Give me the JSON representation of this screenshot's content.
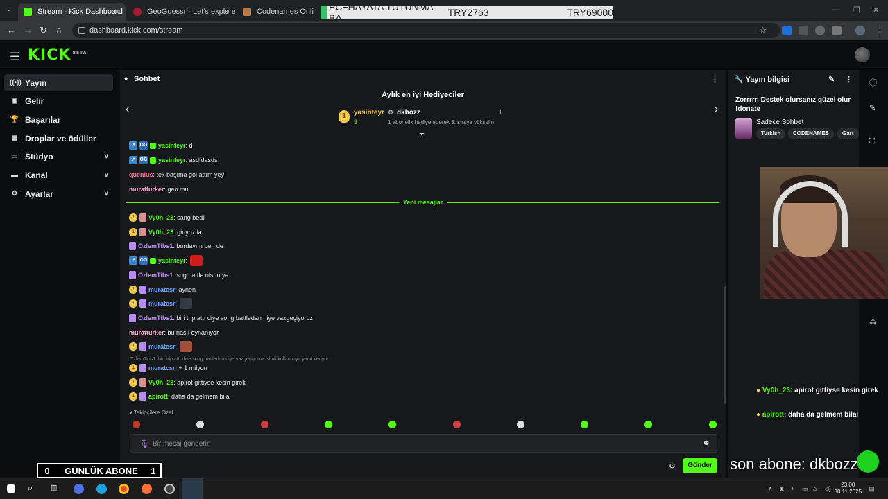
{
  "browser": {
    "tabs": [
      {
        "label": "Stream - Kick Dashboard",
        "active": true,
        "color": "#53fc18"
      },
      {
        "label": "GeoGuessr - Let's explore the w",
        "active": false,
        "color": "#a51c30"
      },
      {
        "label": "Codenames Online",
        "active": false,
        "color": "#b97a4a"
      }
    ],
    "url": "dashboard.kick.com/stream"
  },
  "banner": {
    "left": "PC+HAYATA TUTUNMA BA",
    "middle": "TRY2763",
    "right": "TRY69000"
  },
  "kick": {
    "logo": "KICK",
    "logo_sup": "BETA"
  },
  "sidebar": {
    "items": [
      {
        "label": "Yayın",
        "icon": "broadcast-icon",
        "active": true
      },
      {
        "label": "Gelir",
        "icon": "income-icon"
      },
      {
        "label": "Başarılar",
        "icon": "trophy-icon"
      },
      {
        "label": "Droplar ve ödüller",
        "icon": "gift-icon"
      },
      {
        "label": "Stüdyo",
        "icon": "studio-icon",
        "expandable": true
      },
      {
        "label": "Kanal",
        "icon": "channel-icon",
        "expandable": true
      },
      {
        "label": "Ayarlar",
        "icon": "settings-icon",
        "expandable": true
      }
    ]
  },
  "chat": {
    "header": "Sohbet",
    "gifters_title": "Aylık en iyi Hediyeciler",
    "top_gifter": {
      "rank": "1",
      "name": "yasinteyr",
      "count": "3"
    },
    "second": {
      "name": "dkbozz",
      "count": "1",
      "hint": "1 abonelik hediye ederek 3. sıraya yükselin"
    },
    "new_messages": "Yeni mesajlar",
    "messages_before": [
      {
        "user": "yasinteyr",
        "text": ": d",
        "color": "#53fc18",
        "badges": [
          "pin",
          "og",
          "sub"
        ]
      },
      {
        "user": "yasinteyr",
        "text": ": asdfdasds",
        "color": "#53fc18",
        "badges": [
          "pin",
          "og",
          "sub"
        ]
      },
      {
        "user": "quenius",
        "text": ": tek başıma gol attım yey",
        "color": "#ff6b8a",
        "badges": []
      },
      {
        "user": "muratturker",
        "text": ": geo mu",
        "color": "#f0a8c8",
        "badges": []
      }
    ],
    "messages_after": [
      {
        "user": "Vy0h_23",
        "text": ": sang bedil",
        "color": "#53fc18",
        "badges": [
          "coin",
          "gift"
        ]
      },
      {
        "user": "Vy0h_23",
        "text": ": giriyoz la",
        "color": "#53fc18",
        "badges": [
          "coin",
          "gift"
        ]
      },
      {
        "user": "OzlemTibs1",
        "text": ": burdayım ben de",
        "color": "#b58df0",
        "badges": [
          "party"
        ]
      },
      {
        "user": "yasinteyr",
        "text": ":",
        "color": "#53fc18",
        "badges": [
          "pin",
          "og",
          "sub"
        ],
        "emote": "#d01b1b"
      },
      {
        "user": "OzlemTibs1",
        "text": ": sog battle olsun ya",
        "color": "#b58df0",
        "badges": [
          "party"
        ]
      },
      {
        "user": "muratcsr",
        "text": ": aynen",
        "color": "#6fa8ff",
        "badges": [
          "coin",
          "party"
        ]
      },
      {
        "user": "muratcsr",
        "text": ":",
        "color": "#6fa8ff",
        "badges": [
          "coin",
          "party"
        ],
        "emote": "#333b44"
      },
      {
        "user": "OzlemTibs1",
        "text": ": biri trip attı diye song battledan niye vazgeçiyoruz",
        "color": "#b58df0",
        "badges": [
          "party"
        ]
      },
      {
        "user": "muratturker",
        "text": ": bu nasıl oynanıyor",
        "color": "#f0a8c8",
        "badges": []
      },
      {
        "user": "muratcsr",
        "text": ":",
        "color": "#6fa8ff",
        "badges": [
          "coin",
          "party"
        ],
        "emote": "#a0503a"
      },
      {
        "user": "muratcsr",
        "text": ": + 1 milyon",
        "color": "#6fa8ff",
        "badges": [
          "coin",
          "party"
        ]
      },
      {
        "user": "Vy0h_23",
        "text": ": apirot gittiyse kesin girek",
        "color": "#53fc18",
        "badges": [
          "coin",
          "gift"
        ]
      },
      {
        "user": "apirott",
        "text": ": daha da gelmem bilal",
        "color": "#53fc18",
        "badges": [
          "coin",
          "party"
        ]
      }
    ],
    "reply_note": "OzlemTibs1: biri trip attı diye song battledan niye vazgeçiyoruz isimli kullanıcıya yanıt veriyor",
    "follower_only": "Takipçilere Özel",
    "input_placeholder": "Bir mesaj gönderin",
    "send": "Gönder"
  },
  "info": {
    "header": "Yayın bilgisi",
    "title": "Zorrrrr. Destek olursanız güzel olur !donate",
    "category": "Sadece Sohbet",
    "tags": [
      "Turkish",
      "CODENAMES",
      "Gart"
    ]
  },
  "overlay": {
    "chat": [
      {
        "user": "Vy0h_23",
        "text": ": apirot gittiyse kesin girek"
      },
      {
        "user": "apirott",
        "text": ": daha da gelmem bilal"
      }
    ],
    "last_sub": "son abone: dkbozz",
    "daily_left": "0",
    "daily_label": "GÜNLÜK ABONE",
    "daily_right": "1"
  },
  "taskbar": {
    "time": "23:00",
    "date": "30.11.2025"
  }
}
